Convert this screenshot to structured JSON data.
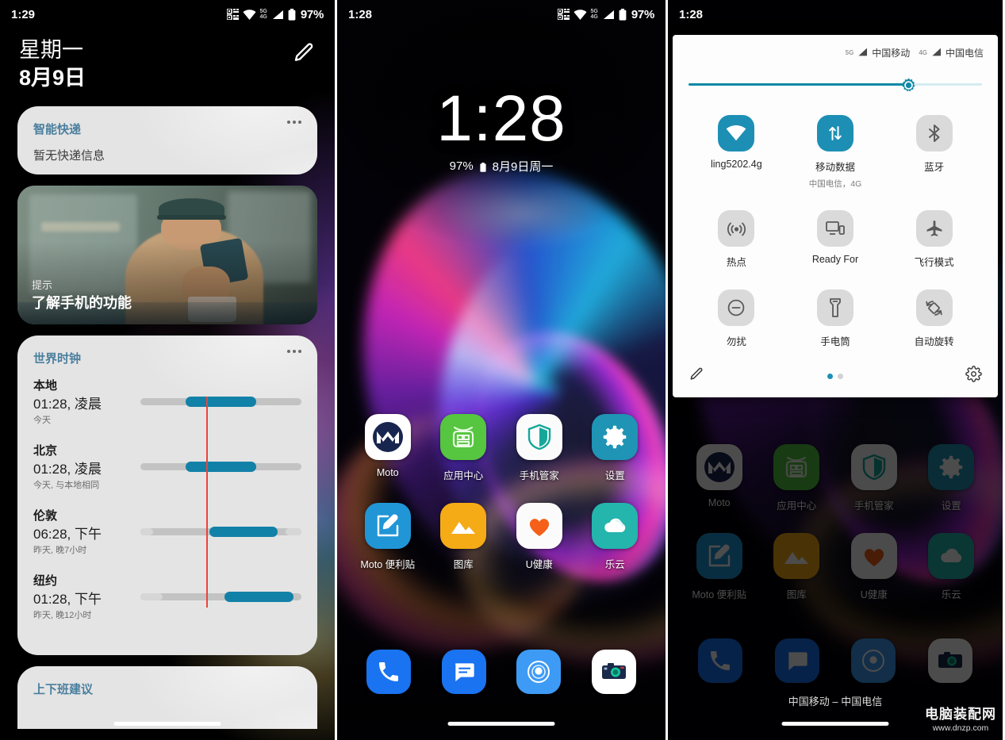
{
  "left_screen": {
    "statusbar": {
      "time": "1:29",
      "battery_percent": "97%",
      "net_5g": "5G",
      "net_4g": "4G",
      "icons": [
        "qr-scan-icon",
        "wifi-icon",
        "signal-icon",
        "battery-icon"
      ]
    },
    "header": {
      "weekday": "星期一",
      "date": "8月9日",
      "edit_icon": "pencil-icon"
    },
    "cards": {
      "express": {
        "title": "智能快递",
        "body": "暂无快递信息",
        "overflow": "more-options-icon"
      },
      "tip": {
        "kicker": "提示",
        "title": "了解手机的功能"
      },
      "world_clock": {
        "title": "世界时钟",
        "overflow": "more-options-icon",
        "rows": [
          {
            "city": "本地",
            "time": "01:28, 凌晨",
            "note": "今天",
            "fill_start_pct": 28,
            "fill_end_pct": 72
          },
          {
            "city": "北京",
            "time": "01:28, 凌晨",
            "note": "今天, 与本地相同",
            "fill_start_pct": 28,
            "fill_end_pct": 72
          },
          {
            "city": "伦敦",
            "time": "06:28, 下午",
            "note": "昨天, 晚7小时",
            "fill_start_pct": 43,
            "fill_end_pct": 85
          },
          {
            "city": "纽约",
            "time": "01:28, 下午",
            "note": "昨天, 晚12小时",
            "fill_start_pct": 52,
            "fill_end_pct": 95
          }
        ],
        "now_marker_pct": 28
      },
      "commute": {
        "title": "上下班建议"
      }
    }
  },
  "mid_screen": {
    "statusbar": {
      "time": "1:28",
      "battery_percent": "97%",
      "net_5g": "5G",
      "net_4g": "4G"
    },
    "clock_widget": {
      "time": "1:28",
      "battery": "97%",
      "date": "8月9日周一",
      "battery_icon": "battery-icon"
    },
    "apps": [
      {
        "label": "Moto",
        "icon": "moto-icon",
        "bg": "#ffffff",
        "fg": "#1d2c55"
      },
      {
        "label": "应用中心",
        "icon": "app-center-icon",
        "bg": "#56c540",
        "fg": "#ffffff"
      },
      {
        "label": "手机管家",
        "icon": "phone-manager-icon",
        "bg": "#fbfbfb",
        "fg": "#16a79a"
      },
      {
        "label": "设置",
        "icon": "settings-gear-icon",
        "bg": "#1f94b5",
        "fg": "#ffffff"
      },
      {
        "label": "Moto 便利贴",
        "icon": "moto-note-icon",
        "bg": "#2196d6",
        "fg": "#ffffff"
      },
      {
        "label": "图库",
        "icon": "gallery-icon",
        "bg": "#f5ab16",
        "fg": "#ffffff"
      },
      {
        "label": "U健康",
        "icon": "u-health-icon",
        "bg": "#fbfbfb",
        "fg": "#f4601a"
      },
      {
        "label": "乐云",
        "icon": "le-cloud-icon",
        "bg": "#24b5ac",
        "fg": "#ffffff"
      }
    ],
    "dock": [
      {
        "label": "phone",
        "icon": "phone-icon",
        "bg": "#1a73f0",
        "fg": "#ffffff"
      },
      {
        "label": "message",
        "icon": "message-icon",
        "bg": "#1a73f0",
        "fg": "#ffffff"
      },
      {
        "label": "browser",
        "icon": "browser-icon",
        "bg": "#3d9bf5",
        "fg": "#ffffff"
      },
      {
        "label": "camera",
        "icon": "camera-icon",
        "bg": "#ffffff",
        "fg": "#1a2a4a"
      }
    ]
  },
  "right_screen": {
    "statusbar": {
      "time": "1:28"
    },
    "quick_settings": {
      "carriers": [
        {
          "gen": "5G",
          "name": "中国移动"
        },
        {
          "gen": "4G",
          "name": "中国电信"
        }
      ],
      "brightness": {
        "value_pct": 75,
        "icon": "brightness-icon"
      },
      "tiles": [
        {
          "label": "ling5202.4g",
          "sub": "",
          "icon": "wifi-icon",
          "state": "on"
        },
        {
          "label": "移动数据",
          "sub": "中国电信，4G",
          "icon": "mobile-data-icon",
          "state": "on"
        },
        {
          "label": "蓝牙",
          "sub": "",
          "icon": "bluetooth-icon",
          "state": "off"
        },
        {
          "label": "热点",
          "sub": "",
          "icon": "hotspot-icon",
          "state": "off"
        },
        {
          "label": "Ready For",
          "sub": "",
          "icon": "ready-for-icon",
          "state": "off"
        },
        {
          "label": "飞行模式",
          "sub": "",
          "icon": "airplane-icon",
          "state": "off"
        },
        {
          "label": "勿扰",
          "sub": "",
          "icon": "do-not-disturb-icon",
          "state": "off"
        },
        {
          "label": "手电筒",
          "sub": "",
          "icon": "flashlight-icon",
          "state": "off"
        },
        {
          "label": "自动旋转",
          "sub": "",
          "icon": "auto-rotate-icon",
          "state": "off"
        }
      ],
      "footer": {
        "edit_icon": "pencil-icon",
        "settings_icon": "gear-icon",
        "pages": 2,
        "active_page": 1
      }
    },
    "carrier_bottom": "中国移动 – 中国电信",
    "watermark": {
      "cn": "电脑装配网",
      "url": "www.dnzp.com"
    }
  },
  "colors": {
    "accent_teal": "#1d8fb5",
    "card_bg": "#e4e4e4",
    "card_title": "#4a7f9e",
    "now_marker": "#e8443a",
    "clock_fill": "#1281a8"
  }
}
